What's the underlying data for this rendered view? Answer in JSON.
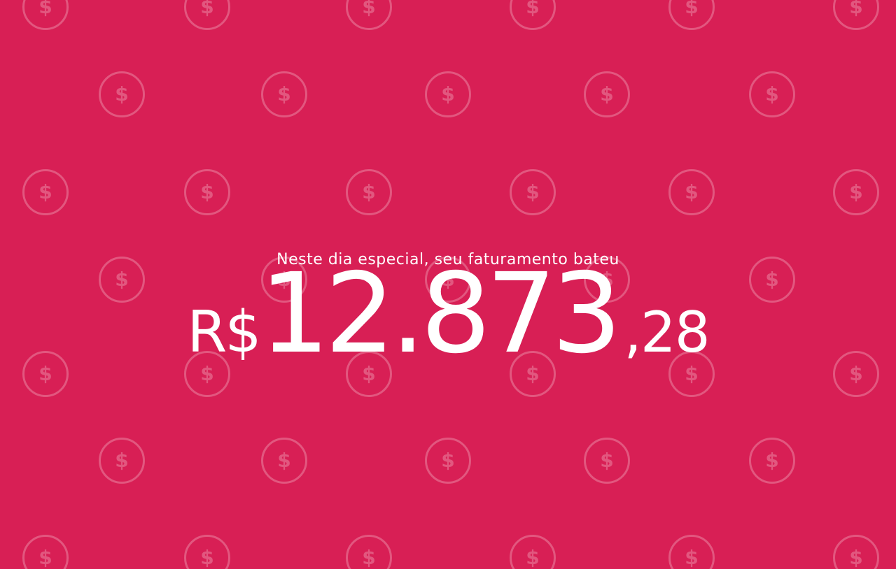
{
  "background_color": "#d81f55",
  "pattern": {
    "icon": "dollar-coin-icon",
    "glyph": "$"
  },
  "headline": "Neste dia especial, seu faturamento bateu",
  "amount": {
    "currency": "R$",
    "integer": "12.873",
    "cents": ",28"
  }
}
